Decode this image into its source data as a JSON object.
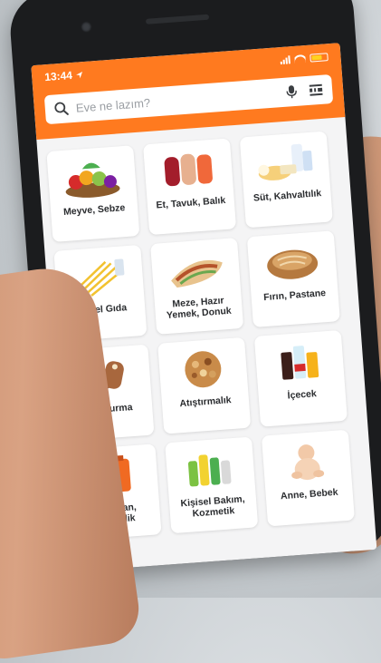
{
  "status_bar": {
    "time": "13:44"
  },
  "search": {
    "placeholder": "Eve ne lazım?"
  },
  "categories": [
    {
      "label": "Meyve, Sebze",
      "icon": "produce-image"
    },
    {
      "label": "Et, Tavuk, Balık",
      "icon": "meat-image"
    },
    {
      "label": "Süt, Kahvaltılık",
      "icon": "dairy-image"
    },
    {
      "label": "Temel Gıda",
      "icon": "pasta-image"
    },
    {
      "label": "Meze, Hazır Yemek, Donuk",
      "icon": "wrap-image"
    },
    {
      "label": "Fırın, Pastane",
      "icon": "bread-image"
    },
    {
      "label": "Dondurma",
      "icon": "icecream-image"
    },
    {
      "label": "Atıştırmalık",
      "icon": "nuts-image"
    },
    {
      "label": "İçecek",
      "icon": "drinks-image"
    },
    {
      "label": "Deterjan, Temizlik",
      "icon": "detergent-image"
    },
    {
      "label": "Kişisel Bakım, Kozmetik",
      "icon": "cosmetics-image"
    },
    {
      "label": "Anne, Bebek",
      "icon": "baby-image"
    }
  ],
  "colors": {
    "brand": "#ff7a1f",
    "screen_bg": "#f4f4f5"
  }
}
